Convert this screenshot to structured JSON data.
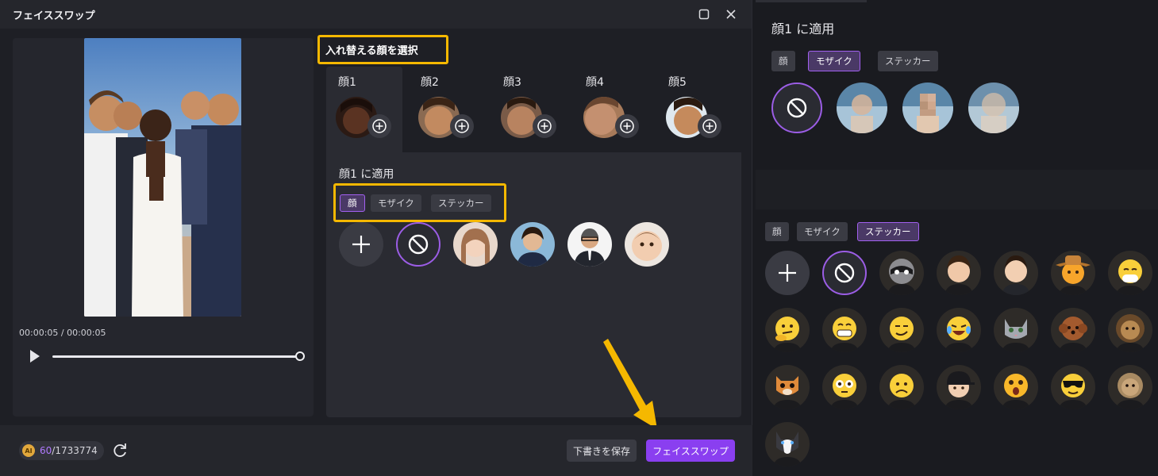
{
  "dialog": {
    "title": "フェイススワップ",
    "maximize_icon": "maximize-icon",
    "close_icon": "close-icon"
  },
  "preview": {
    "time": "00:00:05 / 00:00:05",
    "progress": 1.0
  },
  "select_label": "入れ替える顔を選択",
  "face_tabs": [
    {
      "label": "顔1",
      "active": true
    },
    {
      "label": "顔2",
      "active": false
    },
    {
      "label": "顔3",
      "active": false
    },
    {
      "label": "顔4",
      "active": false
    },
    {
      "label": "顔5",
      "active": false
    }
  ],
  "apply": {
    "title": "顔1 に適用",
    "modes": [
      "顔",
      "モザイク",
      "ステッカー"
    ],
    "active_mode": "顔",
    "options": [
      "add",
      "none",
      "woman-smiling",
      "woman-business",
      "man-suit",
      "baby"
    ]
  },
  "bottom": {
    "credits_used": "60",
    "credits_total": "/1733774",
    "coin_label": "AI",
    "save_draft": "下書きを保存",
    "face_swap": "フェイススワップ"
  },
  "mosaic_panel": {
    "title": "顔1 に適用",
    "modes": [
      "顔",
      "モザイク",
      "ステッカー"
    ],
    "active_mode": "モザイク",
    "options": [
      "none",
      "blur-light",
      "pixelate",
      "blur-strong"
    ]
  },
  "sticker_panel": {
    "modes": [
      "顔",
      "モザイク",
      "ステッカー"
    ],
    "active_mode": "ステッカー",
    "stickers": [
      "add",
      "none",
      "raccoon",
      "cartoon-man-1",
      "cartoon-man-2",
      "cowboy-emoji",
      "sneezing-emoji",
      "thinking-emoji",
      "grinning-emoji",
      "smirk-emoji",
      "laughing-emoji",
      "cat",
      "poodle",
      "lion",
      "tiger-cub",
      "flushed-emoji",
      "worried-emoji",
      "cap-boy",
      "surprised-emoji",
      "sunglasses-emoji",
      "lioness",
      "husky"
    ]
  },
  "colors": {
    "accent": "#8a3ff0",
    "highlight": "#f5b800",
    "panel": "#2a2b32"
  }
}
